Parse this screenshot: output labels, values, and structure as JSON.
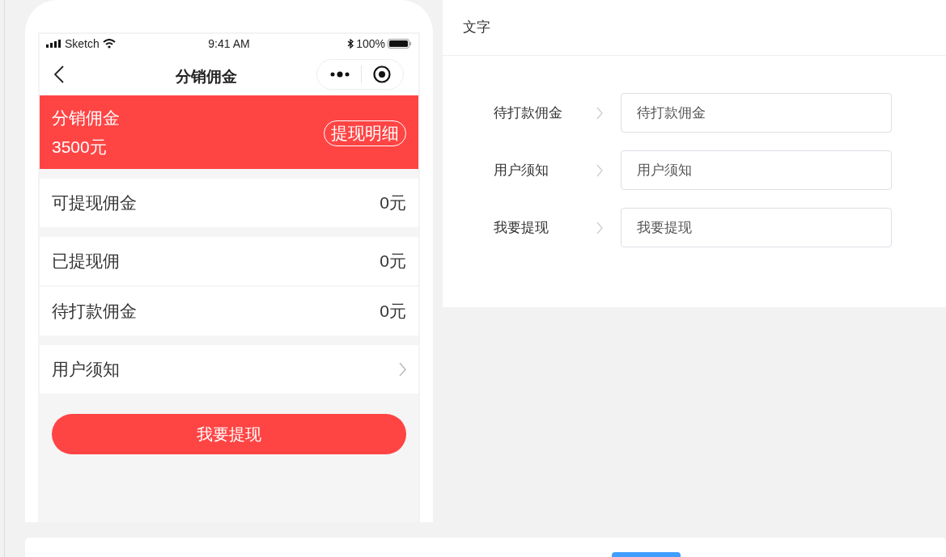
{
  "phone": {
    "status_bar": {
      "carrier": "Sketch",
      "time": "9:41 AM",
      "battery": "100%"
    },
    "nav": {
      "title": "分销佣金"
    },
    "banner": {
      "title": "分销佣金",
      "amount": "3500元",
      "button": "提现明细"
    },
    "groups": [
      [
        {
          "kind": "value",
          "label": "可提现佣金",
          "value": "0元"
        }
      ],
      [
        {
          "kind": "value",
          "label": "已提现佣",
          "value": "0元"
        },
        {
          "kind": "value",
          "label": "待打款佣金",
          "value": "0元"
        }
      ],
      [
        {
          "kind": "link",
          "label": "用户须知"
        }
      ]
    ],
    "button": "我要提现"
  },
  "panel": {
    "header": "文字",
    "rows": [
      {
        "label": "待打款佣金",
        "value": "待打款佣金"
      },
      {
        "label": "用户须知",
        "value": "用户须知"
      },
      {
        "label": "我要提现",
        "value": "我要提现"
      }
    ]
  }
}
